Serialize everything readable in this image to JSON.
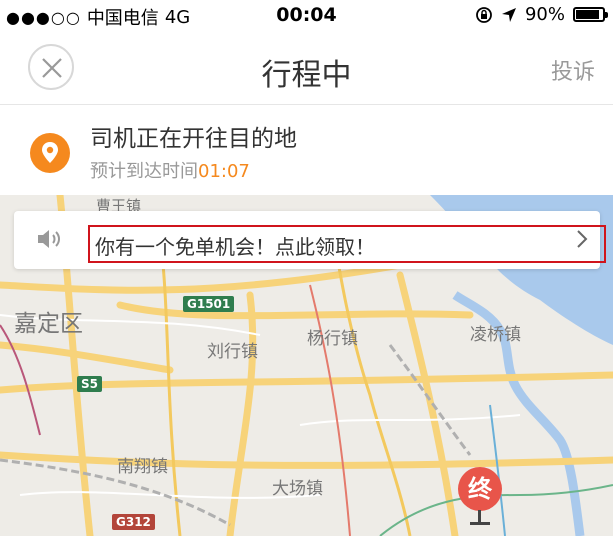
{
  "status_bar": {
    "signal": "●●●○○",
    "carrier": "中国电信",
    "network": "4G",
    "time": "00:04",
    "battery": "90%",
    "battery_level": 0.9
  },
  "navbar": {
    "title": "行程中",
    "action": "投诉"
  },
  "trip": {
    "status": "司机正在开往目的地",
    "eta_prefix": "预计到达时间",
    "eta_time": "01:07"
  },
  "notice": {
    "text": "你有一个免单机会！点此领取！"
  },
  "map": {
    "labels": {
      "caowang": "曹王镇",
      "jiading": "嘉定区",
      "liuxing": "刘行镇",
      "yangxing": "杨行镇",
      "lingqiao": "凌桥镇",
      "nanxiang": "南翔镇",
      "dachang": "大场镇"
    },
    "shields": {
      "g1501": "G1501",
      "s5": "S5",
      "g312": "G312"
    },
    "destination_marker": "终"
  }
}
